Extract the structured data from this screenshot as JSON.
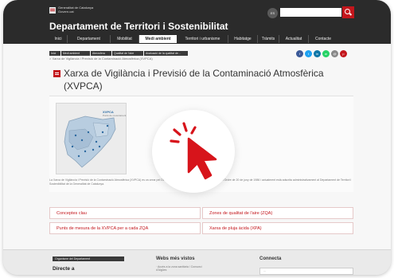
{
  "gencat": {
    "line1": "Generalitat de Catalunya",
    "line2": "Govern.cat"
  },
  "site_title": "Departament de Territori i Sostenibilitat",
  "lang_label": "ES",
  "search": {
    "placeholder": "",
    "icon": "search-icon"
  },
  "nav": [
    "Inici",
    "Departament",
    "Mobilitat",
    "Medi ambient",
    "Territori i urbanisme",
    "Habitatge",
    "Tràmits",
    "Actualitat",
    "Contacte"
  ],
  "nav_active": "Medi ambient",
  "breadcrumb": [
    "Inici",
    "Medi ambient",
    "Atmosfera",
    "Qualitat de l'aire",
    "Avaluació de la qualitat de..."
  ],
  "breadcrumb_current": "> Xarxa de Vigilància i Previsió de la Contaminació Atmosfèrica (XVPCA)",
  "share_icons": [
    {
      "name": "facebook-icon",
      "glyph": "f",
      "color": "#3b5998"
    },
    {
      "name": "twitter-icon",
      "glyph": "t",
      "color": "#1da1f2"
    },
    {
      "name": "linkedin-icon",
      "glyph": "in",
      "color": "#0e76a8"
    },
    {
      "name": "whatsapp-icon",
      "glyph": "w",
      "color": "#25d366"
    },
    {
      "name": "email-icon",
      "glyph": "@",
      "color": "#888888"
    },
    {
      "name": "print-icon",
      "glyph": "p",
      "color": "#c3161c"
    }
  ],
  "page_title": "Xarxa de Vigilància i Previsió de la Contaminació Atmosfèrica (XVPCA)",
  "map": {
    "title": "XVPCA",
    "subtitle": "Punts de mesurament"
  },
  "description": "La Xarxa de Vigilància i Previsió de la Contaminació Atmosfèrica (XVPCA) es va crear pel Decret 322/1987, de 21 de novembre, definits per l'Ordre de 20 de juny de 1986 i actualment està adscrita administrativament al Departament de Territori i Sostenibilitat de la Generalitat de Catalunya.",
  "links": [
    "Conceptes clau",
    "Zones de qualitat de l'aire (ZQA)",
    "Punts de mesura de la XVPCA per a cada ZQA",
    "Xarxa de pluja àcida (XPA)"
  ],
  "footer": {
    "tag": "Organisme del Departament",
    "col1_heading": "Directe a",
    "col2_heading": "Webs més vistos",
    "col2_text": "· Accés a la zona sanitària / Consorci d'Aigües",
    "col3_heading": "Connecta",
    "col3_box": "..."
  },
  "colors": {
    "accent": "#c3161c",
    "dark": "#2b2b2b",
    "link_text": "#c3161c"
  }
}
